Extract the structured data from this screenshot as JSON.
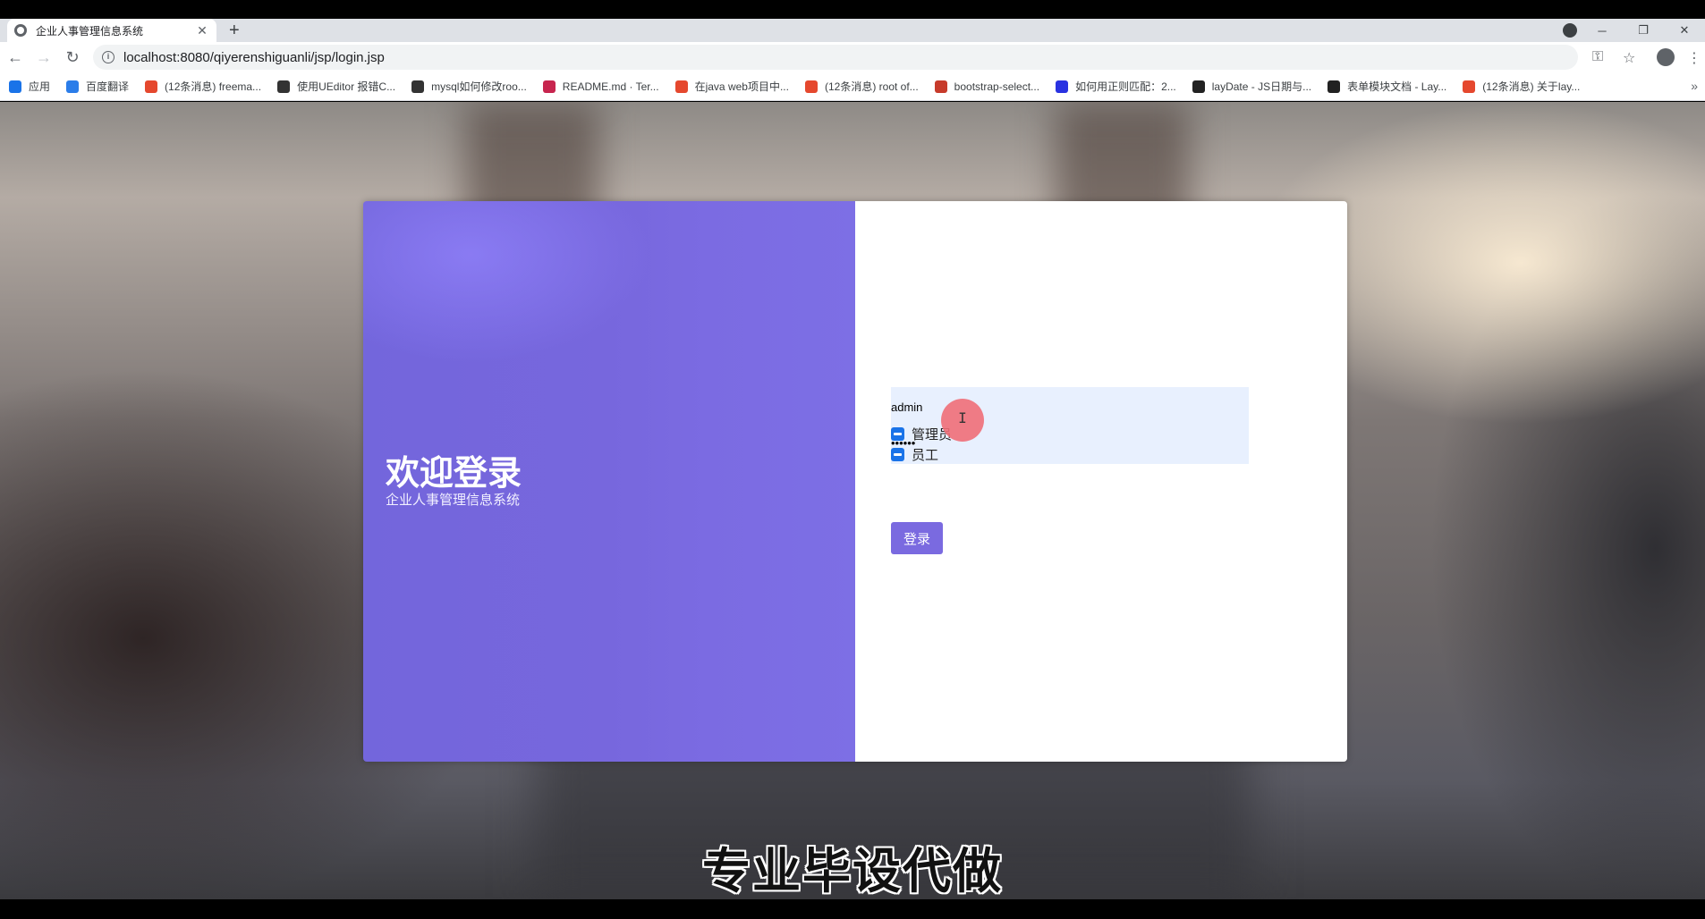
{
  "browser": {
    "tab_title": "企业人事管理信息系统",
    "tab_close": "✕",
    "new_tab": "+",
    "url": "localhost:8080/qiyerenshiguanli/jsp/login.jsp",
    "window_controls": {
      "minimize": "─",
      "restore": "❐",
      "close": "✕"
    }
  },
  "bookmarks": [
    {
      "label": "应用",
      "color": "#1a73e8"
    },
    {
      "label": "百度翻译",
      "color": "#2b7de9"
    },
    {
      "label": "(12条消息) freema...",
      "color": "#e5482e"
    },
    {
      "label": "使用UEditor 报错C...",
      "color": "#333333"
    },
    {
      "label": "mysql如何修改roo...",
      "color": "#333333"
    },
    {
      "label": "README.md · Ter...",
      "color": "#c7254e"
    },
    {
      "label": "在java web项目中...",
      "color": "#e5482e"
    },
    {
      "label": "(12条消息) root of...",
      "color": "#e5482e"
    },
    {
      "label": "bootstrap-select...",
      "color": "#c73b2b"
    },
    {
      "label": "如何用正则匹配：2...",
      "color": "#2932e1"
    },
    {
      "label": "layDate - JS日期与...",
      "color": "#222222"
    },
    {
      "label": "表单模块文档 - Lay...",
      "color": "#222222"
    },
    {
      "label": "(12条消息) 关于lay...",
      "color": "#e5482e"
    }
  ],
  "login": {
    "welcome": "欢迎登录",
    "system_name": "企业人事管理信息系统",
    "username_value": "admin",
    "password_value": "••••••",
    "roles": [
      {
        "label": "管理员"
      },
      {
        "label": "员工"
      }
    ],
    "submit_label": "登录"
  },
  "cursor_glyph": "I",
  "caption": "专业毕设代做",
  "colors": {
    "accent": "#7a6ae0",
    "checkbox": "#1a73e8",
    "autofill_bg": "#e8f0fe"
  }
}
